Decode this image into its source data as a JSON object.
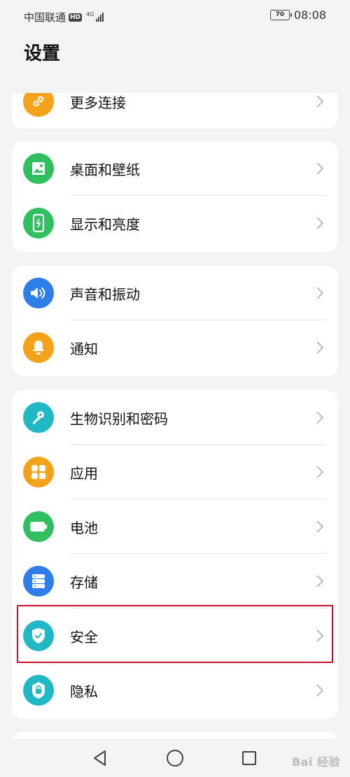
{
  "status_bar": {
    "carrier": "中国联通",
    "hd_badge": "HD",
    "network_type": "4G",
    "battery_level": "70",
    "time": "08:08"
  },
  "page_title": "设置",
  "groups": [
    {
      "items": [
        {
          "label": "更多连接",
          "icon": "link-icon",
          "color": "#f5a21b"
        }
      ]
    },
    {
      "items": [
        {
          "label": "桌面和壁纸",
          "icon": "wallpaper-icon",
          "color": "#2fbf5f"
        },
        {
          "label": "显示和亮度",
          "icon": "display-icon",
          "color": "#2fbf5f"
        }
      ]
    },
    {
      "items": [
        {
          "label": "声音和振动",
          "icon": "sound-icon",
          "color": "#2f7de8"
        },
        {
          "label": "通知",
          "icon": "bell-icon",
          "color": "#f5a21b"
        }
      ]
    },
    {
      "items": [
        {
          "label": "生物识别和密码",
          "icon": "key-icon",
          "color": "#21b8c6"
        },
        {
          "label": "应用",
          "icon": "apps-icon",
          "color": "#f5a21b"
        },
        {
          "label": "电池",
          "icon": "battery-icon",
          "color": "#2fbf5f"
        },
        {
          "label": "存储",
          "icon": "storage-icon",
          "color": "#2f7de8"
        },
        {
          "label": "安全",
          "icon": "shield-icon",
          "color": "#21b8c6"
        },
        {
          "label": "隐私",
          "icon": "privacy-lock-icon",
          "color": "#21b8c6"
        }
      ]
    }
  ],
  "highlight_color": "#c8102e",
  "watermark": "Bai 经验"
}
